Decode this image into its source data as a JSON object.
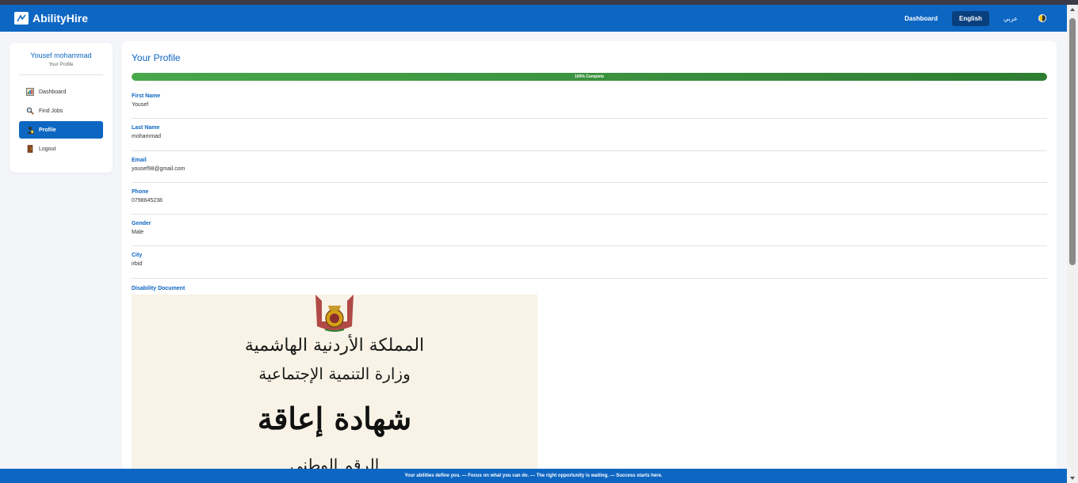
{
  "navbar": {
    "brand": "AbilityHire",
    "links": {
      "dashboard": "Dashboard",
      "english": "English",
      "arabic": "عربي"
    }
  },
  "sidebar": {
    "user_name": "Yousef mohammad",
    "user_sub": "Your Profile",
    "items": [
      {
        "label": "Dashboard",
        "icon": "dashboard-icon"
      },
      {
        "label": "Find Jobs",
        "icon": "search-icon"
      },
      {
        "label": "Profile",
        "icon": "profile-icon"
      },
      {
        "label": "Logout",
        "icon": "logout-icon"
      }
    ]
  },
  "profile": {
    "title": "Your Profile",
    "progress_label": "100% Complete",
    "progress_value": 100,
    "fields": [
      {
        "label": "First Name",
        "value": "Yousef"
      },
      {
        "label": "Last Name",
        "value": "mohammad"
      },
      {
        "label": "Email",
        "value": "yousef98@gmail.com"
      },
      {
        "label": "Phone",
        "value": "0798645238"
      },
      {
        "label": "Gender",
        "value": "Male"
      },
      {
        "label": "City",
        "value": "irbid"
      }
    ],
    "document_label": "Disability Document",
    "document": {
      "line1": "المملكة الأردنية الهاشمية",
      "line2": "وزارة التنمية الإجتماعية",
      "line3": "شهادة إعاقة",
      "line4": "الرقم الوطني"
    }
  },
  "footer": {
    "text": "Your abilities define you. — Focus on what you can do. — The right opportunity is waiting. — Success starts here."
  },
  "colors": {
    "primary": "#0d66c2",
    "active_nav": "#0a3f7d",
    "progress": "#2e7d32"
  }
}
